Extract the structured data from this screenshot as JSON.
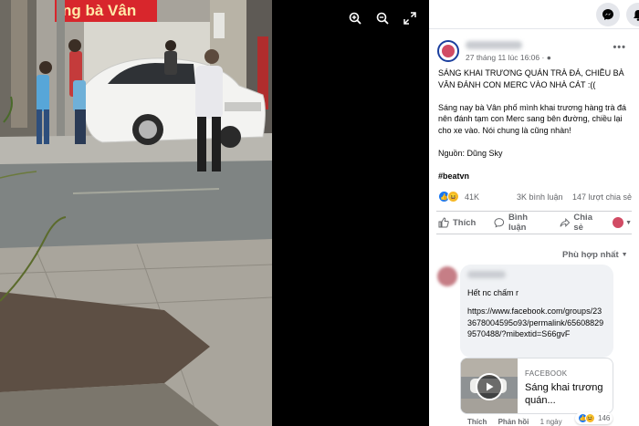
{
  "viewer": {
    "zoom_in_icon": "zoom-in-icon",
    "zoom_out_icon": "zoom-out-icon",
    "fullscreen_icon": "fullscreen-icon"
  },
  "photo": {
    "shop_sign_text": "ng bà Vân"
  },
  "post": {
    "timestamp": "27 tháng 11 lúc 16:06 · ",
    "title": "SÁNG KHAI TRƯƠNG QUÁN TRÀ ĐÁ, CHIỀU BÀ VÂN ĐÁNH CON MERC VÀO NHÀ CÁT :((",
    "body": "Sáng nay bà Vân phố mình khai trương hàng trà đá nên đánh tạm con Merc sang bên đường, chiều lại cho xe vào. Nói chung là cũng nhàn!",
    "source": "Nguồn: Dũng Sky",
    "hashtag": "#beatvn",
    "reaction_count": "41K",
    "comment_count": "3K bình luận",
    "share_count": "147 lượt chia sẻ"
  },
  "actions": {
    "like": "Thích",
    "comment": "Bình luận",
    "share": "Chia sẻ"
  },
  "sort_label": "Phù hợp nhất",
  "comment": {
    "text": "Hết nc chấm r",
    "link": "https://www.facebook.com/groups/233678004595o93/permalink/656088299570488/?mibextid=S66gvF",
    "preview_source": "FACEBOOK",
    "preview_title": "Sáng khai trương quán...",
    "like_label": "Thích",
    "reply_label": "Phản hồi",
    "age": "1 ngày",
    "reaction_count": "146"
  },
  "colors": {
    "accent": "#1877f2",
    "text": "#050505",
    "muted": "#65676b",
    "sign_red": "#d8262c"
  }
}
